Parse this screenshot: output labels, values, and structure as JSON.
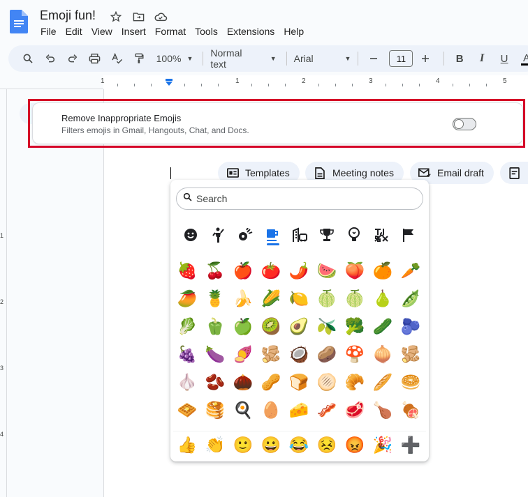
{
  "doc": {
    "title": "Emoji fun!"
  },
  "menu": [
    "File",
    "Edit",
    "View",
    "Insert",
    "Format",
    "Tools",
    "Extensions",
    "Help"
  ],
  "toolbar": {
    "zoom": "100%",
    "style": "Normal text",
    "font": "Arial",
    "font_size": "11",
    "bold": "B",
    "italic": "I",
    "underline": "U",
    "text_color": "A"
  },
  "ruler": {
    "numbers": [
      "1",
      "1",
      "2",
      "3",
      "4",
      "5"
    ]
  },
  "vruler": {
    "numbers": [
      "1",
      "2",
      "3",
      "4"
    ]
  },
  "extension": {
    "title": "Remove Inappropriate Emojis",
    "description": "Filters emojis in Gmail, Hangouts, Chat, and Docs.",
    "enabled": false
  },
  "chips": [
    {
      "label": "Templates",
      "icon": "templates-icon"
    },
    {
      "label": "Meeting notes",
      "icon": "meeting-notes-icon"
    },
    {
      "label": "Email draft",
      "icon": "email-draft-icon"
    }
  ],
  "picker": {
    "search_placeholder": "Search",
    "categories": [
      {
        "name": "smileys",
        "glyph": "☻"
      },
      {
        "name": "people",
        "glyph": "🙋"
      },
      {
        "name": "animals",
        "glyph": "✿"
      },
      {
        "name": "food",
        "glyph": "☕",
        "active": true
      },
      {
        "name": "travel",
        "glyph": "🏢"
      },
      {
        "name": "activities",
        "glyph": "🏆"
      },
      {
        "name": "objects",
        "glyph": "💡"
      },
      {
        "name": "symbols",
        "glyph": "♪"
      },
      {
        "name": "flags",
        "glyph": "⚑"
      }
    ],
    "emojis": [
      "🍓",
      "🍒",
      "🍎",
      "🍅",
      "🌶️",
      "🍉",
      "🍑",
      "🍊",
      "🥕",
      "🥭",
      "🍍",
      "🍌",
      "🌽",
      "🍋",
      "🍈",
      "🍈",
      "🍐",
      "🫛",
      "🥬",
      "🫑",
      "🍏",
      "🥝",
      "🥑",
      "🫒",
      "🥦",
      "🥒",
      "🫐",
      "🍇",
      "🍆",
      "🍠",
      "🫚",
      "🥥",
      "🥔",
      "🍄",
      "🧅",
      "🫚",
      "🧄",
      "🫘",
      "🌰",
      "🥜",
      "🍞",
      "🫓",
      "🥐",
      "🥖",
      "🥯",
      "🧇",
      "🥞",
      "🍳",
      "🥚",
      "🧀",
      "🥓",
      "🥩",
      "🍗",
      "🍖"
    ],
    "recent": [
      "👍",
      "👏",
      "🙂",
      "😀",
      "😂",
      "😣",
      "😡",
      "🎉",
      "➕"
    ]
  },
  "colors": {
    "highlight_border": "#d50027",
    "accent": "#1a73e8",
    "toolbar_bg": "#edf2fa"
  }
}
